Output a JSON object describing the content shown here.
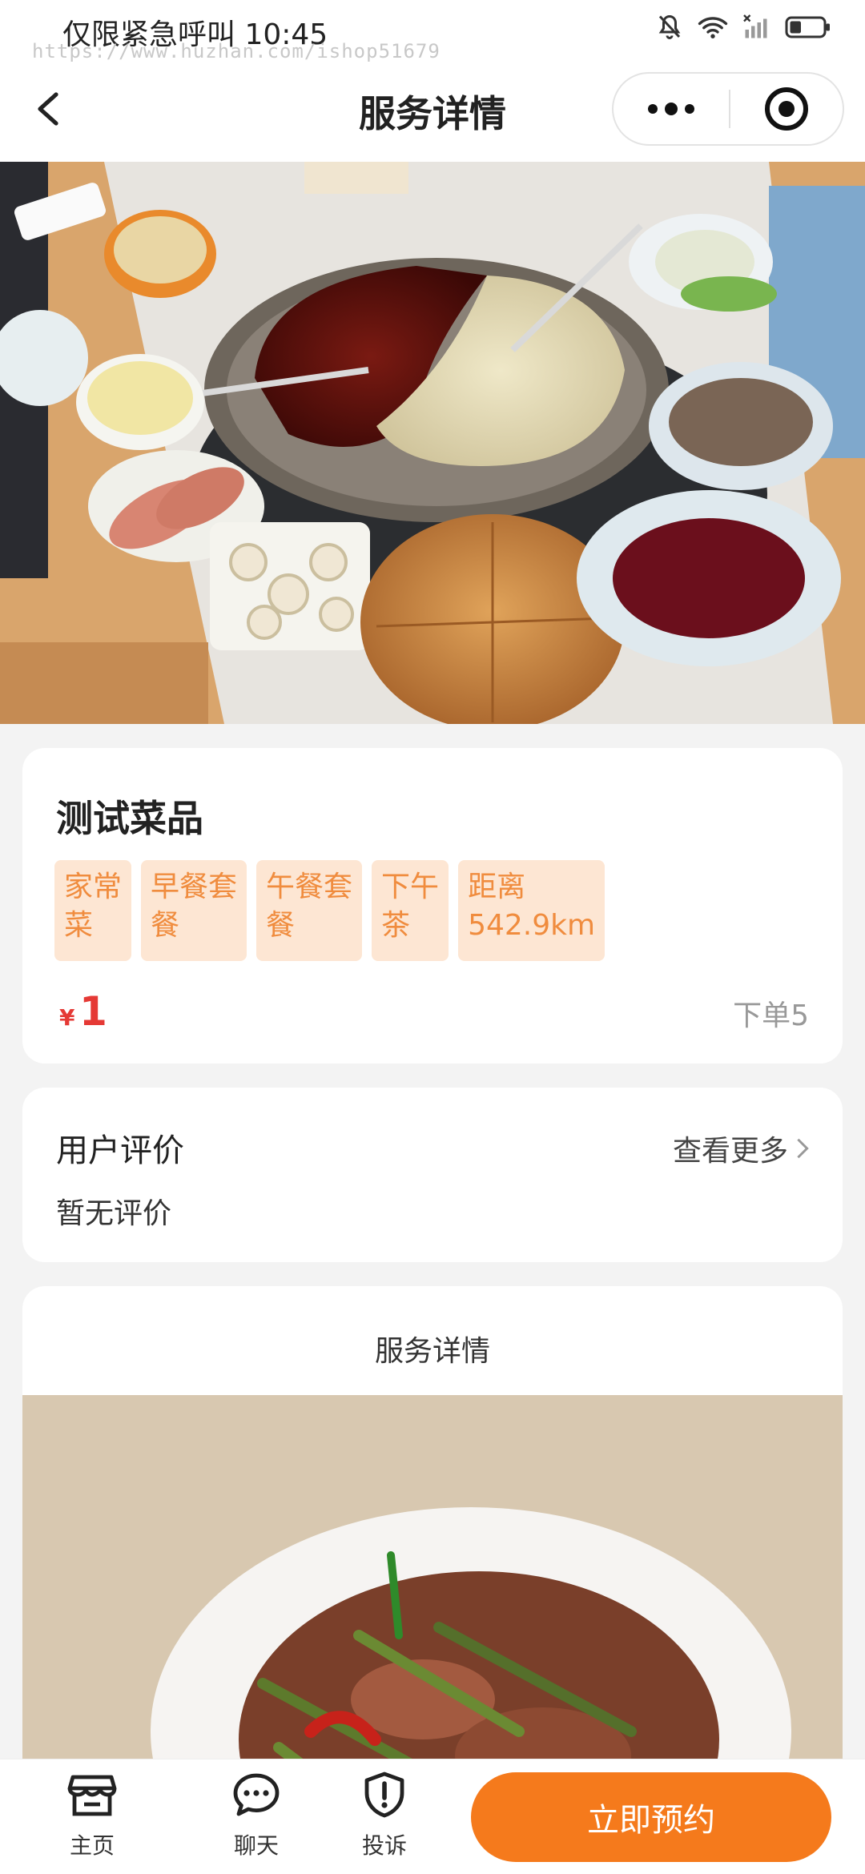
{
  "status_bar": {
    "text": "仅限紧急呼叫 10:45",
    "watermark": "https://www.huzhan.com/ishop51679",
    "icons": [
      "bell-muted-icon",
      "wifi-icon",
      "signal-icon",
      "battery-icon"
    ]
  },
  "navbar": {
    "title": "服务详情",
    "icons": [
      "back-icon",
      "more-dots-icon",
      "target-close-icon"
    ]
  },
  "hero": {
    "image": "hotpot-table-photo"
  },
  "dish": {
    "name": "测试菜品",
    "tags": [
      "家常\n菜",
      "早餐套\n餐",
      "午餐套\n餐",
      "下午\n茶",
      "距离\n542.9km"
    ],
    "currency": "¥",
    "price": "1",
    "orders": "下单5"
  },
  "reviews": {
    "title": "用户评价",
    "more": "查看更多",
    "empty": "暂无评价"
  },
  "details": {
    "title": "服务详情",
    "image": "stir-fry-dish-photo"
  },
  "bottom": {
    "tabs": [
      {
        "label": "主页",
        "icon": "shop-icon"
      },
      {
        "label": "聊天",
        "icon": "chat-icon"
      },
      {
        "label": "投诉",
        "icon": "shield-alert-icon"
      }
    ],
    "book_label": "立即预约"
  },
  "colors": {
    "accent": "#f57a1c",
    "tag_bg": "#fde6d3",
    "tag_text": "#f08c3e",
    "price": "#e53935"
  }
}
